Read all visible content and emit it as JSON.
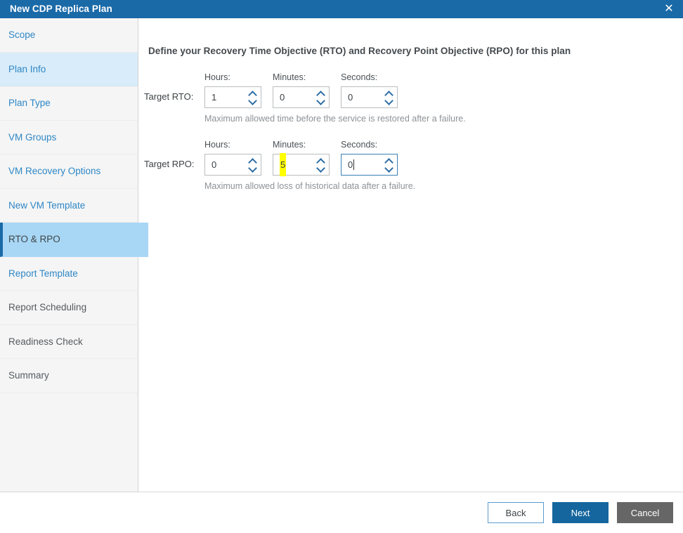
{
  "window": {
    "title": "New CDP Replica Plan",
    "close_icon": "close-icon",
    "titlebar_color": "#1a6aa8"
  },
  "sidebar": {
    "items": [
      {
        "label": "Scope",
        "state": "link"
      },
      {
        "label": "Plan Info",
        "state": "hovered"
      },
      {
        "label": "Plan Type",
        "state": "link"
      },
      {
        "label": "VM Groups",
        "state": "link"
      },
      {
        "label": "VM Recovery Options",
        "state": "link"
      },
      {
        "label": "New VM Template",
        "state": "link"
      },
      {
        "label": "RTO & RPO",
        "state": "active"
      },
      {
        "label": "Report Template",
        "state": "link"
      },
      {
        "label": "Report Scheduling",
        "state": "disabled"
      },
      {
        "label": "Readiness Check",
        "state": "disabled"
      },
      {
        "label": "Summary",
        "state": "disabled"
      }
    ],
    "active_color": "#a8d7f5",
    "hover_color": "#d9ecf9",
    "link_color": "#2e87c6"
  },
  "main": {
    "header": "Define your Recovery Time Objective (RTO) and Recovery Point Objective (RPO) for this plan",
    "rto": {
      "row_label": "Target RTO:",
      "hours_label": "Hours:",
      "minutes_label": "Minutes:",
      "seconds_label": "Seconds:",
      "hours_value": "1",
      "minutes_value": "0",
      "seconds_value": "0",
      "helper": "Maximum allowed time before the service is restored after a failure."
    },
    "rpo": {
      "row_label": "Target RPO:",
      "hours_label": "Hours:",
      "minutes_label": "Minutes:",
      "seconds_label": "Seconds:",
      "hours_value": "0",
      "minutes_value": "5",
      "seconds_value": "0",
      "helper": "Maximum allowed loss of historical data after a failure.",
      "minutes_selection_color": "#ffff00"
    }
  },
  "footer": {
    "back_label": "Back",
    "next_label": "Next",
    "cancel_label": "Cancel",
    "next_color": "#15669e",
    "cancel_color": "#666666"
  }
}
